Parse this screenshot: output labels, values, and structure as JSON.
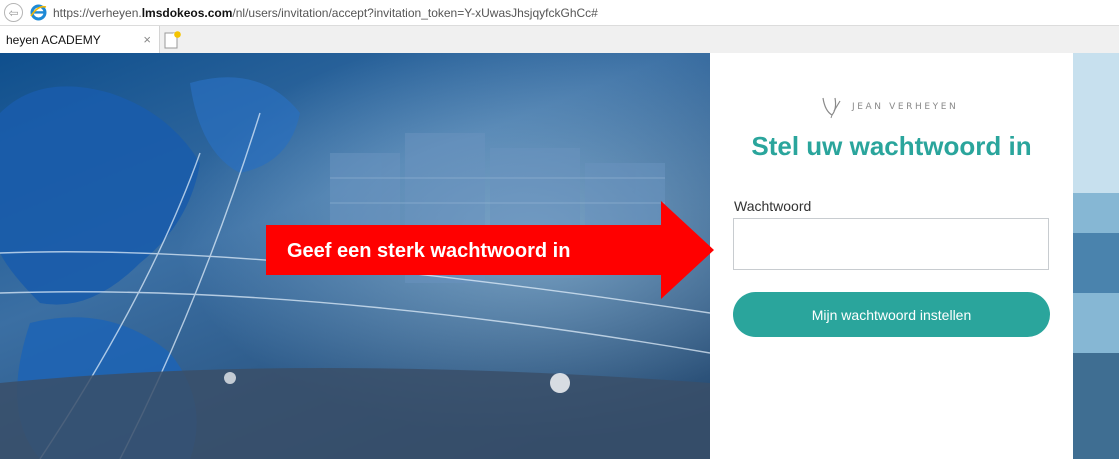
{
  "browser": {
    "url_prefix": "https://verheyen.",
    "url_host": "lmsdokeos.com",
    "url_path": "/nl/users/invitation/accept?invitation_token=Y-xUwasJhsjqyfckGhCc#",
    "tab_title": "heyen ACADEMY",
    "tab_close": "×"
  },
  "panel": {
    "brand_text": "JEAN VERHEYEN",
    "title": "Stel uw wachtwoord in",
    "password_label": "Wachtwoord",
    "password_value": "",
    "submit_label": "Mijn wachtwoord instellen"
  },
  "annotation": {
    "text": "Geef een sterk wachtwoord in",
    "color": "#ff0000"
  },
  "colors": {
    "accent": "#2aa59c",
    "background_blue": "#3b6fa3"
  },
  "icons": {
    "back": "back-arrow-icon",
    "browser": "internet-explorer-icon",
    "new_tab": "new-tab-icon",
    "brand": "jv-monogram-icon"
  }
}
